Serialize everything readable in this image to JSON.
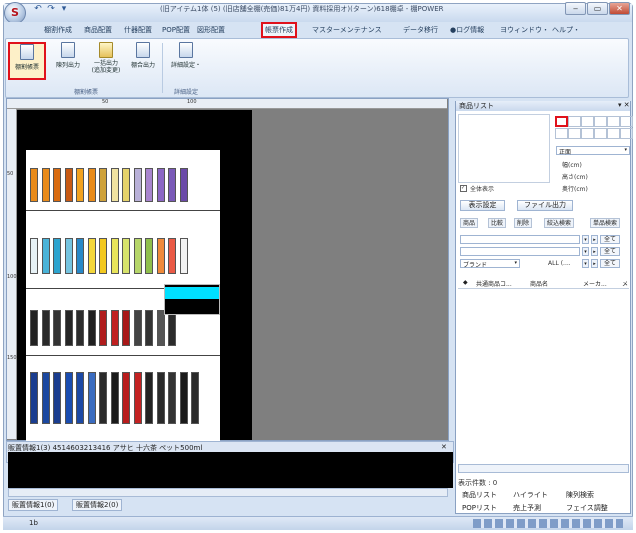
{
  "window": {
    "title": "(旧アイテム1体 (5) (旧店舗全棚(売価)81万4円) 資料採用オ)(ターン)618棚卓 - 棚POWER",
    "qat": [
      "↶",
      "↷",
      "▾"
    ],
    "controls": [
      "‒",
      "▭",
      "✕"
    ]
  },
  "menu_tabs": [
    "棚割作成",
    "商品配置",
    "什器配置",
    "POP配置",
    "図形配置",
    "帳票作成",
    "マスターメンテナンス",
    "データ移行",
    "●ログ情報",
    "ヨウィンドウ・",
    "ヘルプ・"
  ],
  "active_tab_index": 5,
  "ribbon": {
    "buttons": [
      "棚割帳票",
      "陳列出力",
      "一括出力\n(追加変更)",
      "棚合出力",
      "詳細設定・"
    ],
    "groups": [
      "棚割帳票",
      "詳細設定"
    ]
  },
  "canvas": {
    "ruler_marks": [
      "50",
      "100"
    ],
    "left_marks": [
      "50",
      "100",
      "150"
    ]
  },
  "info": {
    "text": "販置情報1(3) 4514603213416 アサヒ 十六茶 ペット500ml",
    "close": "✕"
  },
  "bottom_tabs": [
    "販置情報1(0)",
    "販置情報2(0)"
  ],
  "status": {
    "page": "1b"
  },
  "right_panel": {
    "title": "商品リスト",
    "pin": "▾ ✕",
    "face_select": "正面",
    "fields": [
      "幅(cm)",
      "高さ(cm)",
      "奥行(cm)"
    ],
    "checkbox_label": "全体表示",
    "buttons": [
      "表示設定",
      "ファイル出力"
    ],
    "subtabs": [
      "商品",
      "比較",
      "削除",
      "絞込検索",
      "単品検索"
    ],
    "all_label": "全て",
    "brand_label": "ブランド",
    "all_dots": "ALL (....",
    "list_columns": [
      "◆",
      "共通商品コ...",
      "商品名",
      "メーカ...",
      "メ"
    ],
    "count_label": "表示件数 : 0",
    "links": [
      "商品リスト",
      "ハイライト",
      "陳列検索",
      "POPリスト",
      "売上予測",
      "フェイス調整"
    ]
  }
}
